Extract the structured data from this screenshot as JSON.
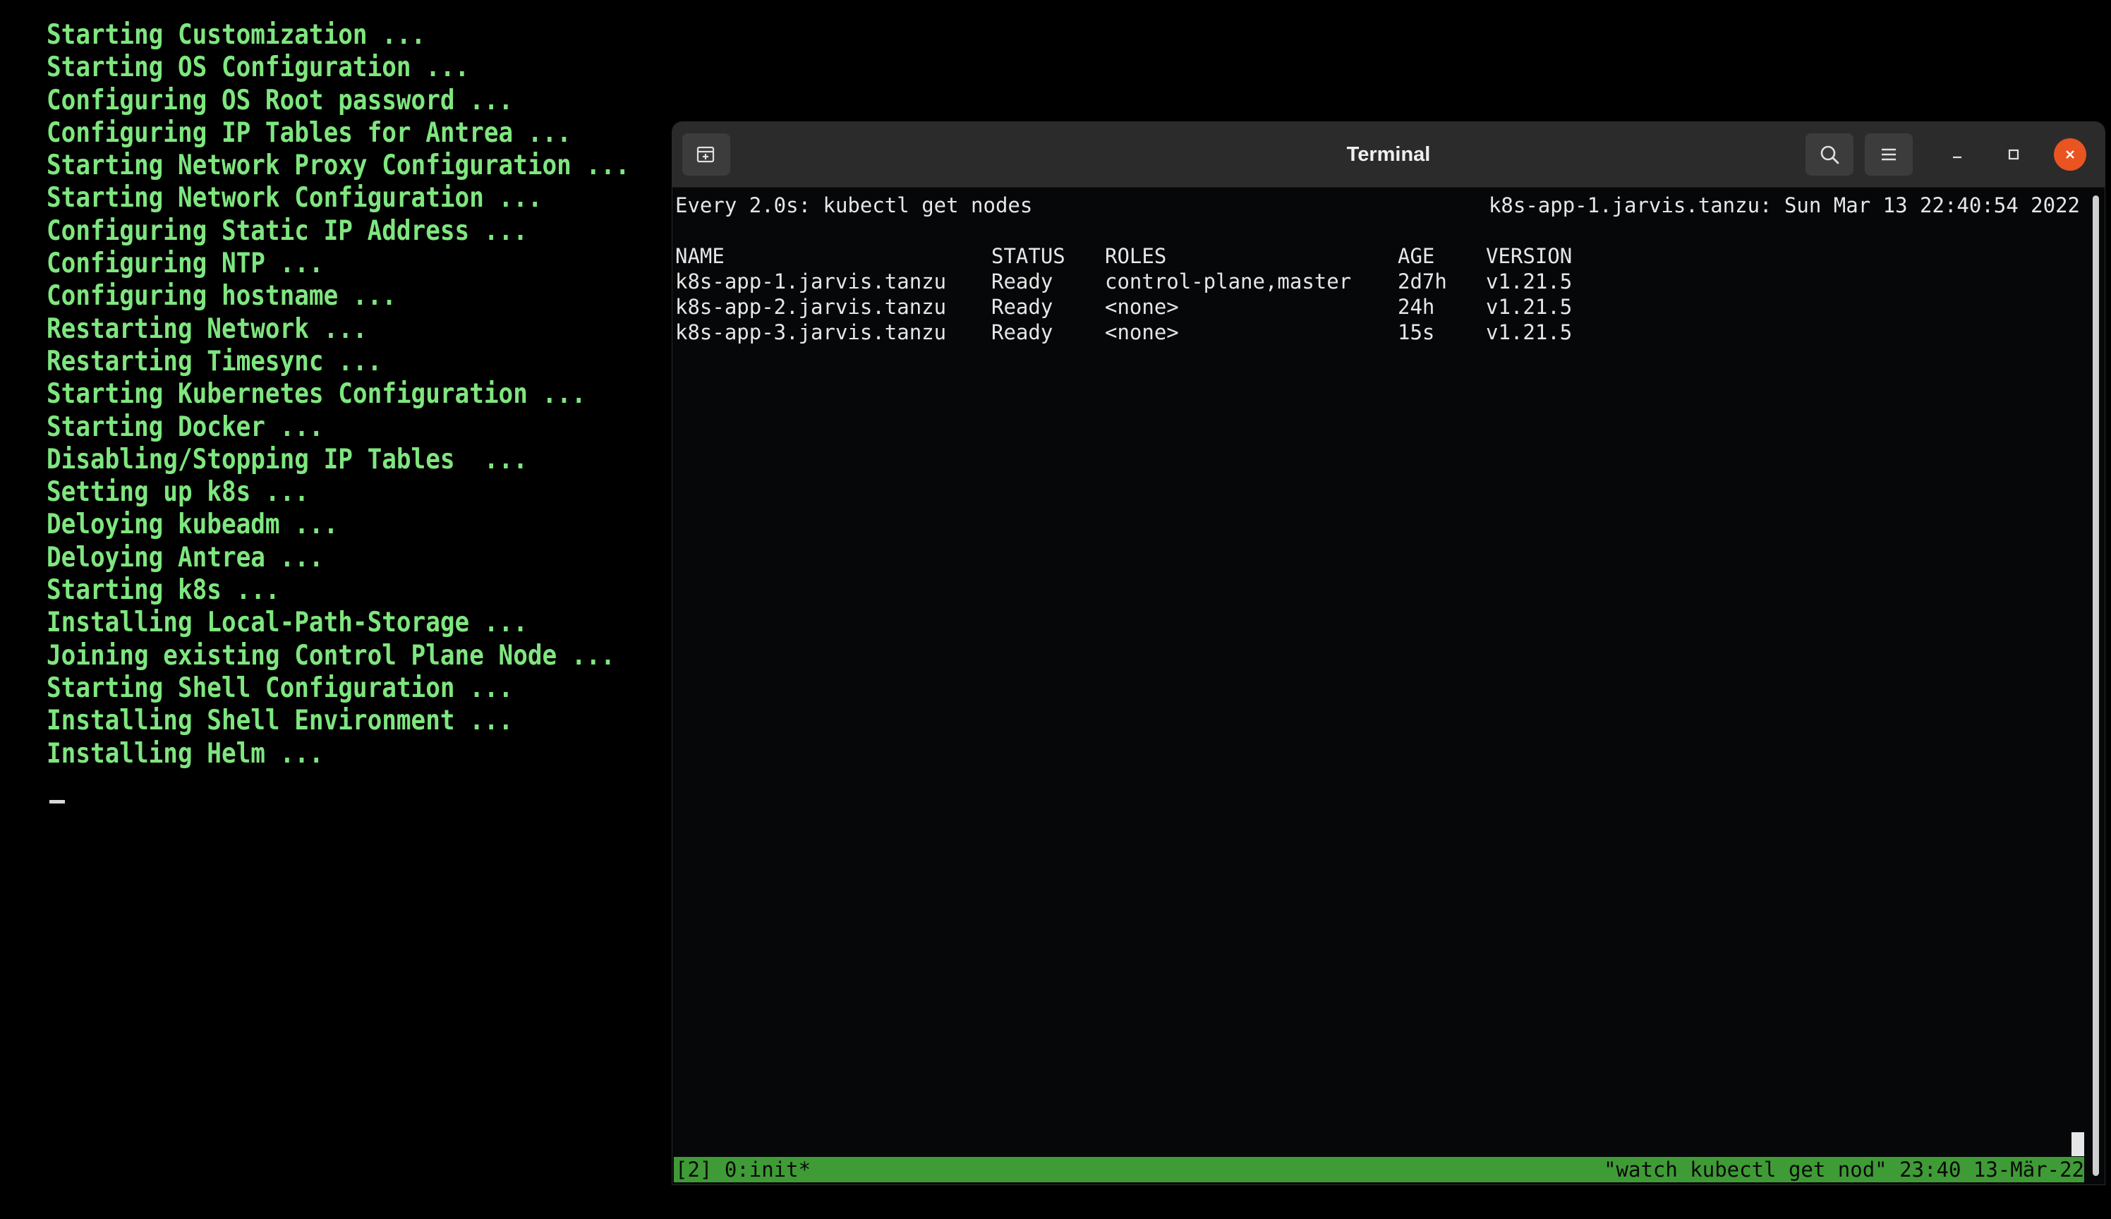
{
  "console": {
    "lines": [
      "Starting Customization ...",
      "Starting OS Configuration ...",
      "Configuring OS Root password ...",
      "Configuring IP Tables for Antrea ...",
      "Starting Network Proxy Configuration ...",
      "Starting Network Configuration ...",
      "Configuring Static IP Address ...",
      "Configuring NTP ...",
      "Configuring hostname ...",
      "Restarting Network ...",
      "Restarting Timesync ...",
      "Starting Kubernetes Configuration ...",
      "Starting Docker ...",
      "Disabling/Stopping IP Tables  ...",
      "Setting up k8s ...",
      "Deloying kubeadm ...",
      "Deloying Antrea ...",
      "Starting k8s ...",
      "Installing Local-Path-Storage ...",
      "Joining existing Control Plane Node ...",
      "Starting Shell Configuration ...",
      "Installing Shell Environment ...",
      "Installing Helm ..."
    ]
  },
  "window": {
    "title": "Terminal",
    "icons": {
      "new_tab": "new-tab-icon",
      "search": "search-icon",
      "menu": "hamburger-menu-icon",
      "minimize": "minimize-icon",
      "maximize": "maximize-icon",
      "close": "close-icon"
    },
    "colors": {
      "close_button": "#e95420",
      "status_bar": "#3f9b36",
      "console_text": "#7fe67f"
    }
  },
  "terminal": {
    "watch_header": "Every 2.0s: kubectl get nodes",
    "watch_host": "k8s-app-1.jarvis.tanzu: Sun Mar 13 22:40:54 2022",
    "table": {
      "headers": [
        "NAME",
        "STATUS",
        "ROLES",
        "AGE",
        "VERSION"
      ],
      "rows": [
        [
          "k8s-app-1.jarvis.tanzu",
          "Ready",
          "control-plane,master",
          "2d7h",
          "v1.21.5"
        ],
        [
          "k8s-app-2.jarvis.tanzu",
          "Ready",
          "<none>",
          "24h",
          "v1.21.5"
        ],
        [
          "k8s-app-3.jarvis.tanzu",
          "Ready",
          "<none>",
          "15s",
          "v1.21.5"
        ]
      ]
    },
    "status_bar": {
      "left": "[2] 0:init*",
      "right": "\"watch kubectl get nod\" 23:40 13-Mär-22"
    }
  }
}
